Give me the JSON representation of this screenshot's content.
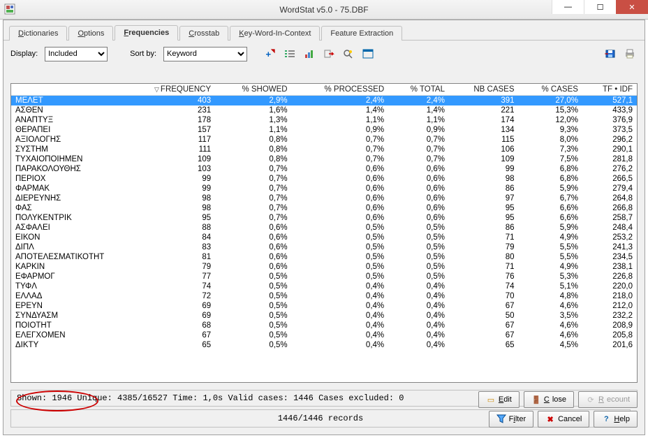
{
  "window": {
    "title": "WordStat v5.0 - 75.DBF"
  },
  "tabs": [
    {
      "label": "Dictionaries",
      "u": 0
    },
    {
      "label": "Options",
      "u": 0
    },
    {
      "label": "Frequencies",
      "u": 0,
      "active": true
    },
    {
      "label": "Crosstab",
      "u": 0
    },
    {
      "label": "Key-Word-In-Context",
      "u": 0
    },
    {
      "label": "Feature Extraction",
      "u": -1
    }
  ],
  "toolbar": {
    "display_label": "Display:",
    "display_value": "Included",
    "sort_label": "Sort by:",
    "sort_value": "Keyword"
  },
  "columns": [
    "",
    "FREQUENCY",
    "% SHOWED",
    "% PROCESSED",
    "% TOTAL",
    "NB CASES",
    "% CASES",
    "TF • IDF"
  ],
  "sort_col": 1,
  "rows": [
    {
      "k": "ΜΕΛΕΤ",
      "v": [
        "403",
        "2,9%",
        "2,4%",
        "2,4%",
        "391",
        "27,0%",
        "527,1"
      ],
      "sel": true
    },
    {
      "k": "ΑΣΘΕΝ",
      "v": [
        "231",
        "1,6%",
        "1,4%",
        "1,4%",
        "221",
        "15,3%",
        "433,9"
      ]
    },
    {
      "k": "ΑΝΑΠΤΥΞ",
      "v": [
        "178",
        "1,3%",
        "1,1%",
        "1,1%",
        "174",
        "12,0%",
        "376,9"
      ]
    },
    {
      "k": "ΘΕΡΑΠΕΙ",
      "v": [
        "157",
        "1,1%",
        "0,9%",
        "0,9%",
        "134",
        "9,3%",
        "373,5"
      ]
    },
    {
      "k": "ΑΞΙΟΛΟΓΗΣ",
      "v": [
        "117",
        "0,8%",
        "0,7%",
        "0,7%",
        "115",
        "8,0%",
        "296,2"
      ]
    },
    {
      "k": "ΣΥΣΤΗΜ",
      "v": [
        "111",
        "0,8%",
        "0,7%",
        "0,7%",
        "106",
        "7,3%",
        "290,1"
      ]
    },
    {
      "k": "ΤΥΧΑΙΟΠΟΙΗΜΕΝ",
      "v": [
        "109",
        "0,8%",
        "0,7%",
        "0,7%",
        "109",
        "7,5%",
        "281,8"
      ]
    },
    {
      "k": "ΠΑΡΑΚΟΛΟΥΘΗΣ",
      "v": [
        "103",
        "0,7%",
        "0,6%",
        "0,6%",
        "99",
        "6,8%",
        "276,2"
      ]
    },
    {
      "k": "ΠΕΡΙΟΧ",
      "v": [
        "99",
        "0,7%",
        "0,6%",
        "0,6%",
        "98",
        "6,8%",
        "266,5"
      ]
    },
    {
      "k": "ΦΑΡΜΑΚ",
      "v": [
        "99",
        "0,7%",
        "0,6%",
        "0,6%",
        "86",
        "5,9%",
        "279,4"
      ]
    },
    {
      "k": "ΔΙΕΡΕΥΝΗΣ",
      "v": [
        "98",
        "0,7%",
        "0,6%",
        "0,6%",
        "97",
        "6,7%",
        "264,8"
      ]
    },
    {
      "k": "ΦΑΣ",
      "v": [
        "98",
        "0,7%",
        "0,6%",
        "0,6%",
        "95",
        "6,6%",
        "266,8"
      ]
    },
    {
      "k": "ΠΟΛΥΚΕΝΤΡΙΚ",
      "v": [
        "95",
        "0,7%",
        "0,6%",
        "0,6%",
        "95",
        "6,6%",
        "258,7"
      ]
    },
    {
      "k": "ΑΣΦΑΛΕΙ",
      "v": [
        "88",
        "0,6%",
        "0,5%",
        "0,5%",
        "86",
        "5,9%",
        "248,4"
      ]
    },
    {
      "k": "ΕΙΚΟΝ",
      "v": [
        "84",
        "0,6%",
        "0,5%",
        "0,5%",
        "71",
        "4,9%",
        "253,2"
      ]
    },
    {
      "k": "ΔΙΠΛ",
      "v": [
        "83",
        "0,6%",
        "0,5%",
        "0,5%",
        "79",
        "5,5%",
        "241,3"
      ]
    },
    {
      "k": "ΑΠΟΤΕΛΕΣΜΑΤΙΚΟΤΗΤ",
      "v": [
        "81",
        "0,6%",
        "0,5%",
        "0,5%",
        "80",
        "5,5%",
        "234,5"
      ]
    },
    {
      "k": "ΚΑΡΚΙΝ",
      "v": [
        "79",
        "0,6%",
        "0,5%",
        "0,5%",
        "71",
        "4,9%",
        "238,1"
      ]
    },
    {
      "k": "ΕΦΑΡΜΟΓ",
      "v": [
        "77",
        "0,5%",
        "0,5%",
        "0,5%",
        "76",
        "5,3%",
        "226,8"
      ]
    },
    {
      "k": "ΤΥΦΛ",
      "v": [
        "74",
        "0,5%",
        "0,4%",
        "0,4%",
        "74",
        "5,1%",
        "220,0"
      ]
    },
    {
      "k": "ΕΛΛΑΔ",
      "v": [
        "72",
        "0,5%",
        "0,4%",
        "0,4%",
        "70",
        "4,8%",
        "218,0"
      ]
    },
    {
      "k": "ΕΡΕΥΝ",
      "v": [
        "69",
        "0,5%",
        "0,4%",
        "0,4%",
        "67",
        "4,6%",
        "212,0"
      ]
    },
    {
      "k": "ΣΥΝΔΥΑΣΜ",
      "v": [
        "69",
        "0,5%",
        "0,4%",
        "0,4%",
        "50",
        "3,5%",
        "232,2"
      ]
    },
    {
      "k": "ΠΟΙΟΤΗΤ",
      "v": [
        "68",
        "0,5%",
        "0,4%",
        "0,4%",
        "67",
        "4,6%",
        "208,9"
      ]
    },
    {
      "k": "ΕΛΕΓΧΟΜΕΝ",
      "v": [
        "67",
        "0,5%",
        "0,4%",
        "0,4%",
        "67",
        "4,6%",
        "205,8"
      ]
    },
    {
      "k": "ΔΙΚΤΥ",
      "v": [
        "65",
        "0,5%",
        "0,4%",
        "0,4%",
        "65",
        "4,5%",
        "201,6"
      ]
    }
  ],
  "status": {
    "text": "Shown: 1946   Unique: 4385/16527   Time: 1,0s   Valid cases: 1446   Cases excluded: 0"
  },
  "records": {
    "text": "1446/1446 records"
  },
  "buttons": {
    "edit": "Edit",
    "close": "Close",
    "recount": "Recount",
    "filter": "Filter",
    "cancel": "Cancel",
    "help": "Help"
  }
}
